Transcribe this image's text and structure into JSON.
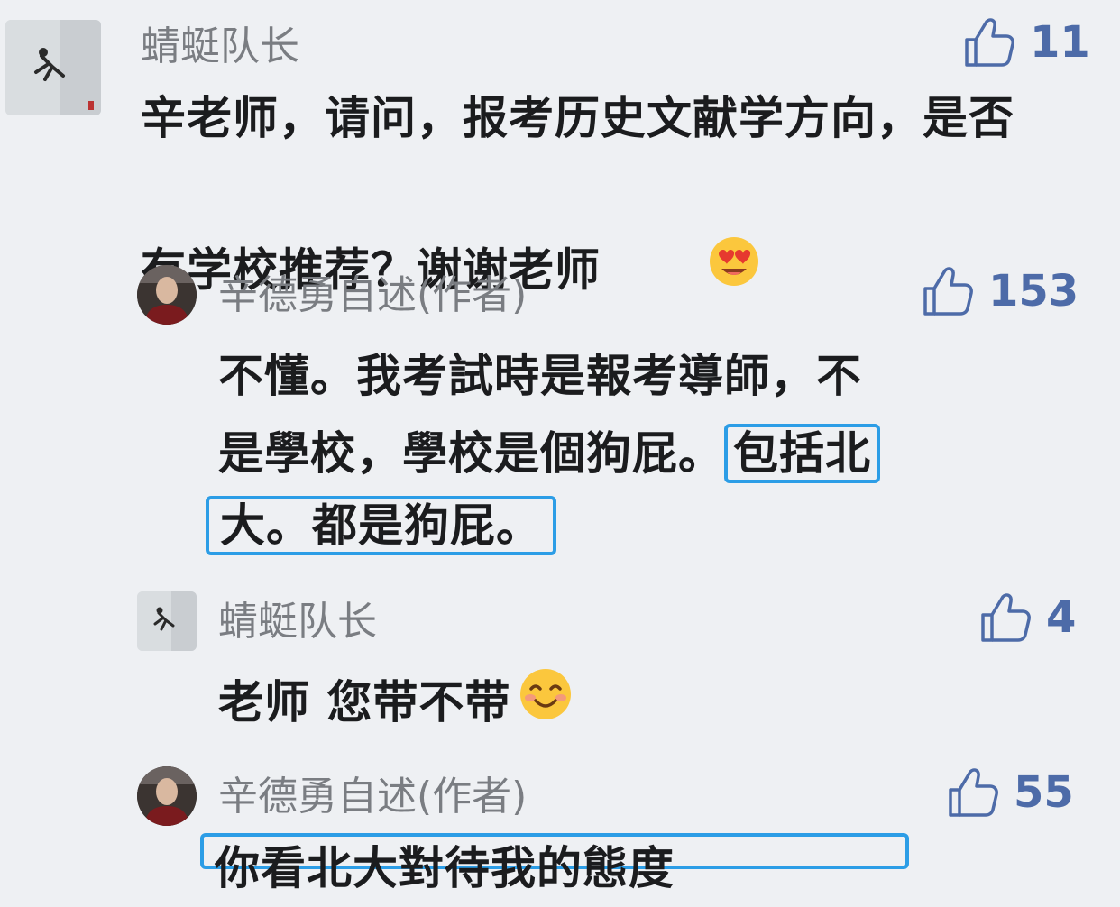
{
  "comments": [
    {
      "username": "蜻蜓队长",
      "likes": "11",
      "text": "辛老师，请问，报考历史文献学方向，是否有学校推荐？谢谢老师",
      "emoji": "heart-eyes-emoji"
    },
    {
      "username": "辛德勇自述(作者)",
      "likes": "153",
      "text_line1": "不懂。我考試時是報考導師，不",
      "text_line2_plain": "是學校，學校是個狗屁。",
      "text_line2_highlight": "包括北",
      "text_line3_highlight": "大。都是狗屁。"
    },
    {
      "username": "蜻蜓队长",
      "likes": "4",
      "text": "老师 您带不带",
      "emoji": "blushing-smile-emoji"
    },
    {
      "username": "辛德勇自述(作者)",
      "likes": "55",
      "text_partial": "你看北大對待我的態度"
    }
  ],
  "colors": {
    "background": "#eef0f3",
    "username": "#7a7d82",
    "text": "#1b1c1e",
    "like": "#4d6ba8",
    "highlight_border": "#2c9de6"
  }
}
